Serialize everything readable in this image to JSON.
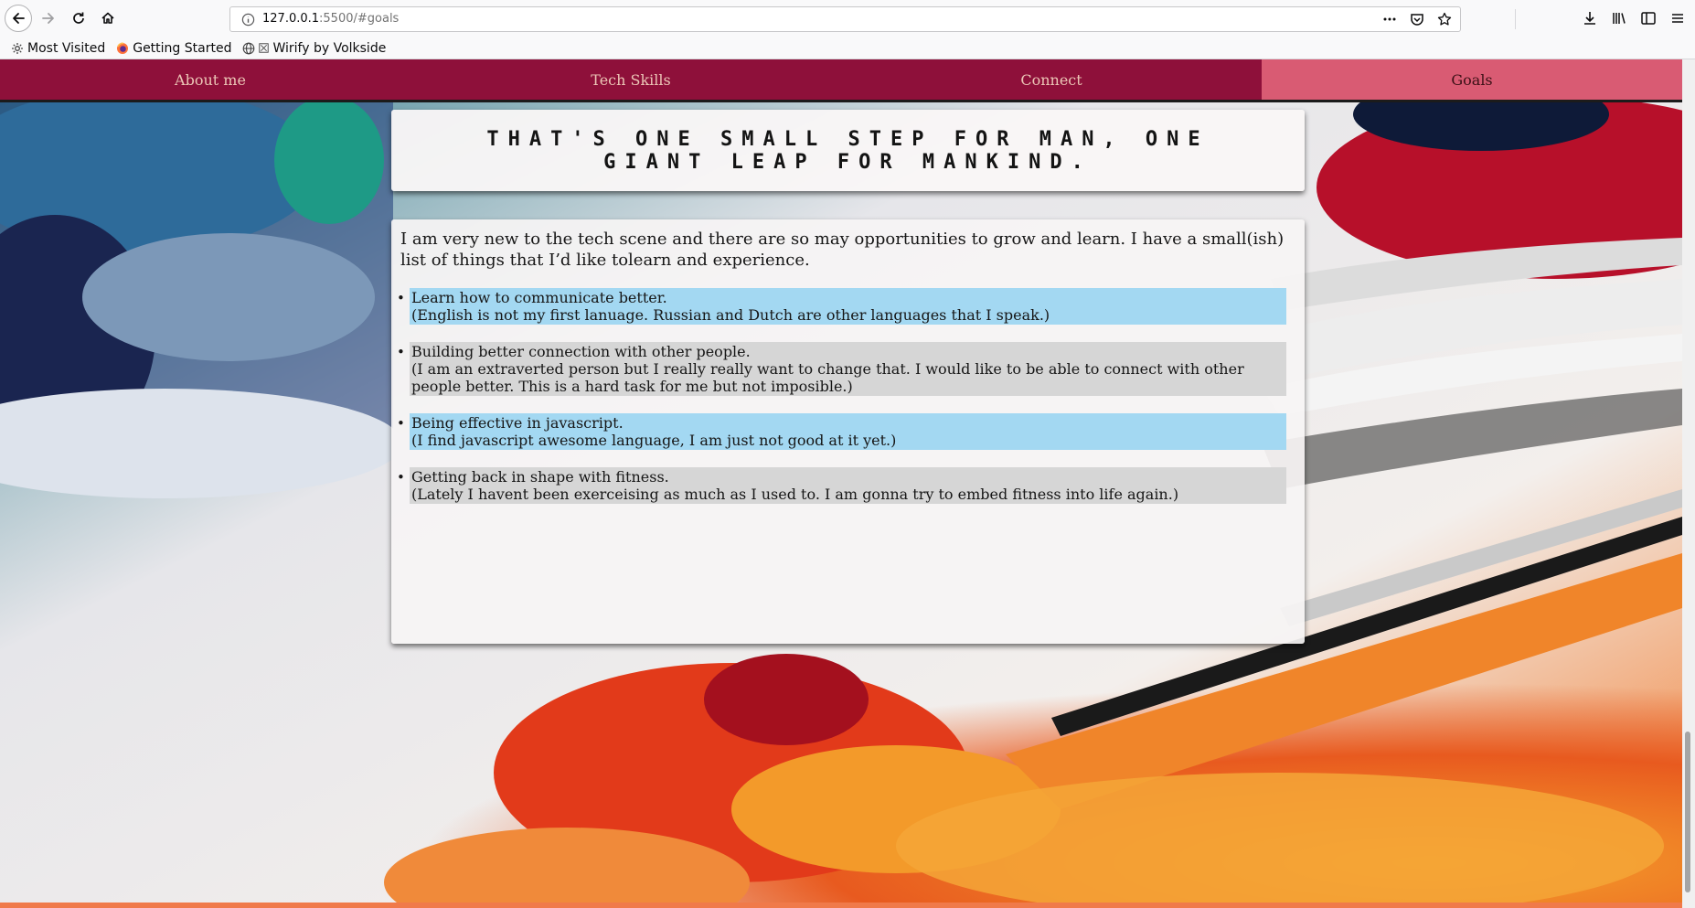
{
  "browser": {
    "url_host": "127.0.0.1",
    "url_rest": ":5500/#goals",
    "bookmarks": [
      {
        "label": "Most Visited",
        "icon": "gear-icon"
      },
      {
        "label": "Getting Started",
        "icon": "firefox-icon"
      },
      {
        "label": "Wirify by Volkside",
        "icon": "globe-icon"
      }
    ]
  },
  "site": {
    "nav": [
      {
        "label": "About me",
        "active": false
      },
      {
        "label": "Tech Skills",
        "active": false
      },
      {
        "label": "Connect",
        "active": false
      },
      {
        "label": "Goals",
        "active": true
      }
    ],
    "quote": "That's one small step for man, one giant leap for mankind.",
    "intro": "I am very new to the tech scene and there are so may opportunities to grow and learn. I have a small(ish) list of things that I’d like tolearn and experience.",
    "goals": [
      {
        "title": "Learn how to communicate better.",
        "detail": "(English is not my first lanuage. Russian and Dutch are other languages that I speak.)",
        "color": "#a3d8f2"
      },
      {
        "title": "Building better connection with other people.",
        "detail": "(I am an extraverted person but I really really want to change that. I would like to be able to connect with other people better. This is a hard task for me but not imposible.)",
        "color": "#d6d6d6"
      },
      {
        "title": "Being effective in javascript.",
        "detail": "(I find javascript awesome language, I am just not good at it yet.)",
        "color": "#a3d8f2"
      },
      {
        "title": "Getting back in shape with fitness.",
        "detail": "(Lately I havent been exerceising as much as I used to. I am gonna try to embed fitness into life again.)",
        "color": "#d6d6d6"
      }
    ]
  },
  "colors": {
    "nav_bg": "#8e103a",
    "nav_active": "#d95b73",
    "goal_blue": "#a3d8f2",
    "goal_gray": "#d6d6d6"
  }
}
